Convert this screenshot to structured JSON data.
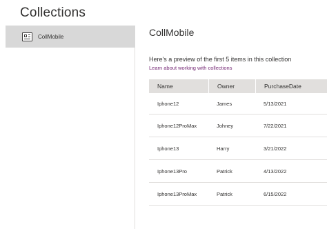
{
  "page": {
    "title": "Collections"
  },
  "sidebar": {
    "items": [
      {
        "label": "CollMobile",
        "icon": "table-icon"
      }
    ]
  },
  "main": {
    "title": "CollMobile",
    "preview_text": "Here's a preview of the first 5 items in this collection",
    "learn_link": "Learn about working with collections",
    "table": {
      "headers": [
        "Name",
        "Owner",
        "PurchaseDate"
      ],
      "rows": [
        [
          "Iphone12",
          "James",
          "5/13/2021"
        ],
        [
          "Iphone12ProMax",
          "Johney",
          "7/22/2021"
        ],
        [
          "Iphone13",
          "Harry",
          "3/21/2022"
        ],
        [
          "Iphone13Pro",
          "Patrick",
          "4/13/2022"
        ],
        [
          "Iphone13ProMax",
          "Patrick",
          "6/15/2022"
        ]
      ]
    }
  },
  "colors": {
    "link": "#742774",
    "selected_bg": "#d8d8d8",
    "header_bg": "#e1dfdd"
  }
}
